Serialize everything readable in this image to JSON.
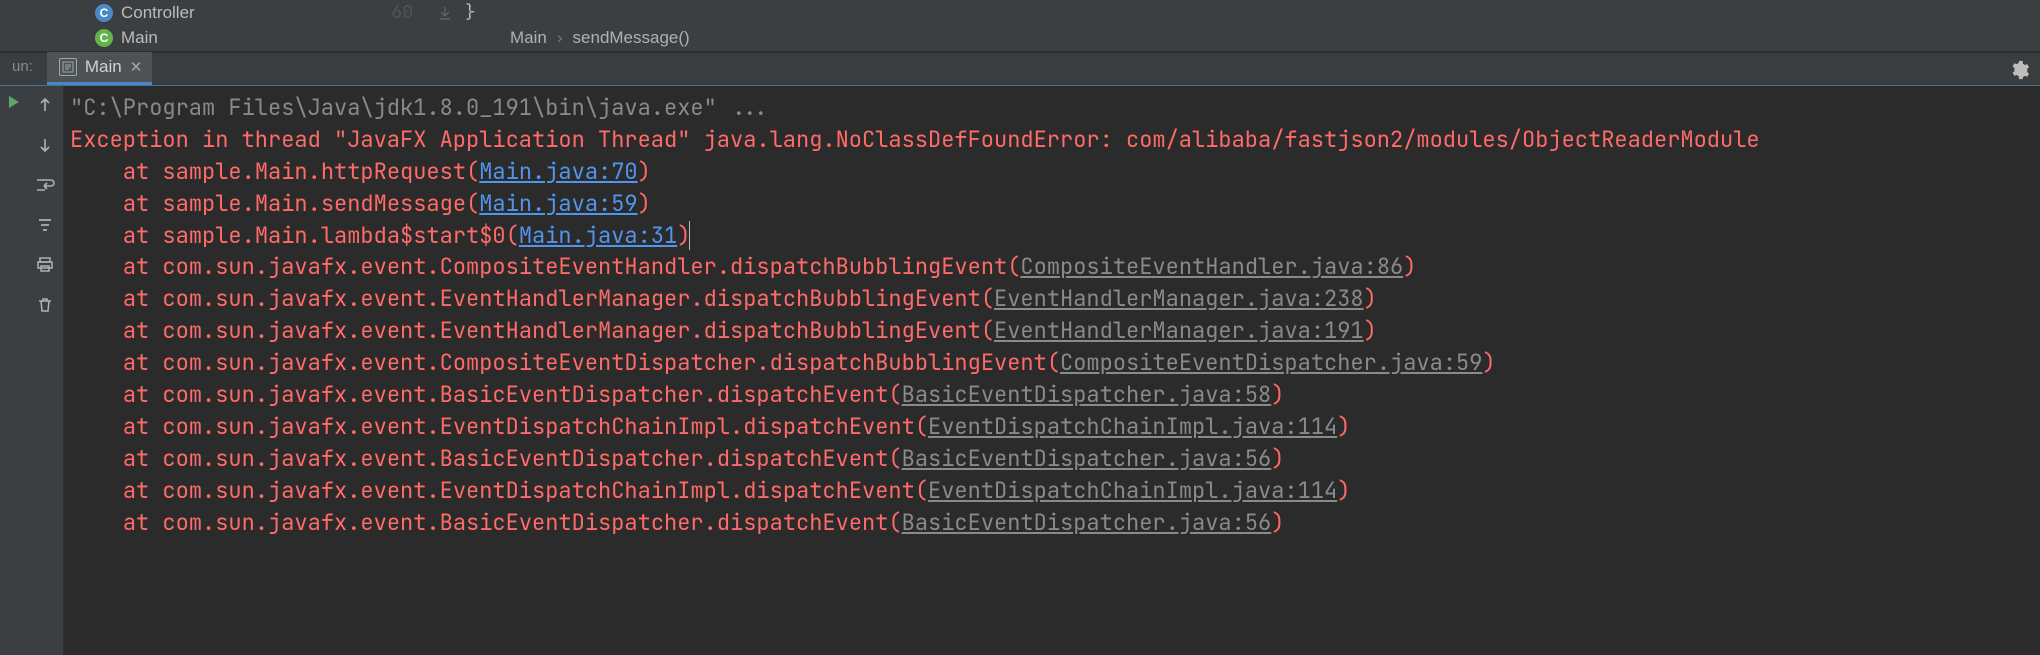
{
  "projectTree": {
    "items": [
      {
        "icon": "C",
        "iconClass": "blue",
        "label": "Controller"
      },
      {
        "icon": "C",
        "iconClass": "green",
        "label": "Main"
      }
    ]
  },
  "editor": {
    "lineNumber": "60",
    "codeText": "}",
    "breadcrumb": {
      "part1": "Main",
      "part2": "sendMessage()"
    }
  },
  "runPanel": {
    "title": "un:",
    "tab": {
      "name": "Main"
    }
  },
  "console": {
    "cmd": "\"C:\\Program Files\\Java\\jdk1.8.0_191\\bin\\java.exe\" ...",
    "exception": "Exception in thread \"JavaFX Application Thread\" java.lang.NoClassDefFoundError: com/alibaba/fastjson2/modules/ObjectReaderModule",
    "frames": [
      {
        "indent": "    ",
        "pre": "at sample.Main.httpRequest(",
        "link": "Main.java:70",
        "linkClass": "c-link",
        "post": ")"
      },
      {
        "indent": "    ",
        "pre": "at sample.Main.sendMessage(",
        "link": "Main.java:59",
        "linkClass": "c-link",
        "post": ")"
      },
      {
        "indent": "    ",
        "pre": "at sample.Main.lambda$start$0(",
        "link": "Main.java:31",
        "linkClass": "c-link",
        "post": ")",
        "caret": true
      },
      {
        "indent": "    ",
        "pre": "at com.sun.javafx.event.CompositeEventHandler.dispatchBubblingEvent(",
        "link": "CompositeEventHandler.java:86",
        "linkClass": "c-mlink",
        "post": ")"
      },
      {
        "indent": "    ",
        "pre": "at com.sun.javafx.event.EventHandlerManager.dispatchBubblingEvent(",
        "link": "EventHandlerManager.java:238",
        "linkClass": "c-mlink",
        "post": ")"
      },
      {
        "indent": "    ",
        "pre": "at com.sun.javafx.event.EventHandlerManager.dispatchBubblingEvent(",
        "link": "EventHandlerManager.java:191",
        "linkClass": "c-mlink",
        "post": ")"
      },
      {
        "indent": "    ",
        "pre": "at com.sun.javafx.event.CompositeEventDispatcher.dispatchBubblingEvent(",
        "link": "CompositeEventDispatcher.java:59",
        "linkClass": "c-mlink",
        "post": ")"
      },
      {
        "indent": "    ",
        "pre": "at com.sun.javafx.event.BasicEventDispatcher.dispatchEvent(",
        "link": "BasicEventDispatcher.java:58",
        "linkClass": "c-mlink",
        "post": ")"
      },
      {
        "indent": "    ",
        "pre": "at com.sun.javafx.event.EventDispatchChainImpl.dispatchEvent(",
        "link": "EventDispatchChainImpl.java:114",
        "linkClass": "c-mlink",
        "post": ")"
      },
      {
        "indent": "    ",
        "pre": "at com.sun.javafx.event.BasicEventDispatcher.dispatchEvent(",
        "link": "BasicEventDispatcher.java:56",
        "linkClass": "c-mlink",
        "post": ")"
      },
      {
        "indent": "    ",
        "pre": "at com.sun.javafx.event.EventDispatchChainImpl.dispatchEvent(",
        "link": "EventDispatchChainImpl.java:114",
        "linkClass": "c-mlink",
        "post": ")"
      },
      {
        "indent": "    ",
        "pre": "at com.sun.javafx.event.BasicEventDispatcher.dispatchEvent(",
        "link": "BasicEventDispatcher.java:56",
        "linkClass": "c-mlink",
        "post": ")"
      }
    ]
  }
}
